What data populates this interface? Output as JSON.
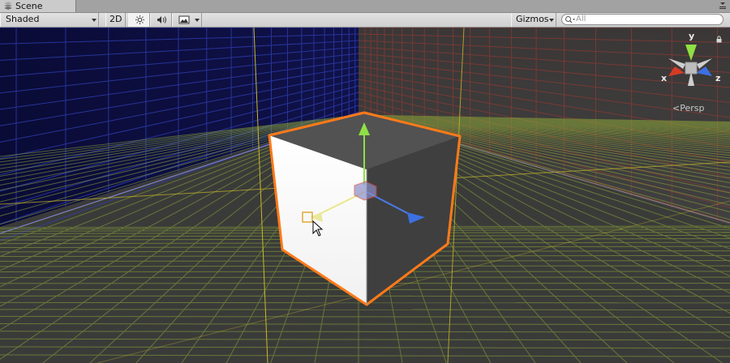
{
  "window": {
    "tab_label": "Scene"
  },
  "toolbar": {
    "draw_mode": "Shaded",
    "mode_2d": "2D",
    "gizmos_label": "Gizmos",
    "search_placeholder": "All"
  },
  "scene": {
    "persp_label": "Persp",
    "axis_labels": {
      "x": "x",
      "y": "y",
      "z": "z"
    }
  },
  "colors": {
    "selection_outline": "#ff7a1a",
    "axis_x": "#d63b24",
    "axis_y": "#8fe044",
    "axis_z": "#3c6fe0",
    "sky_left": "#0b0c3a",
    "ground": "#3a3a3a"
  }
}
